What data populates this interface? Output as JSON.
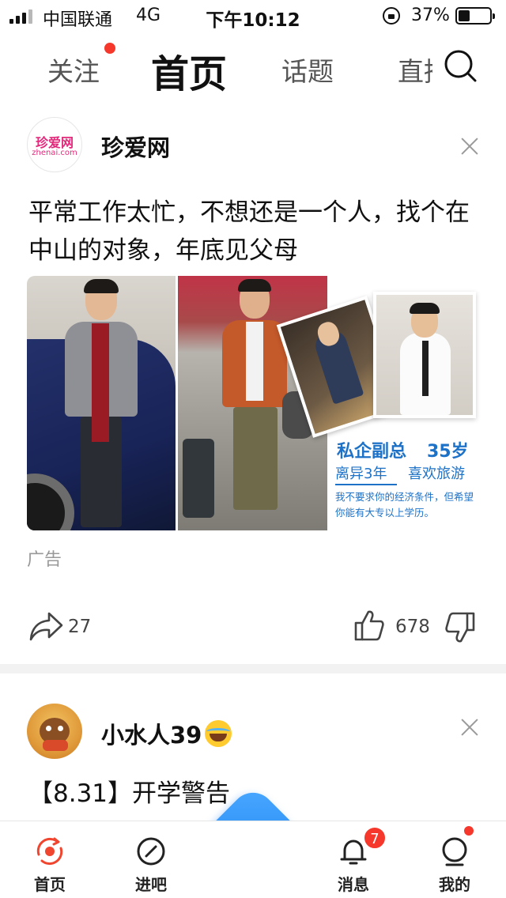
{
  "status_bar": {
    "carrier": "中国联通",
    "network": "4G",
    "time": "下午10:12",
    "battery_percent": "37%",
    "battery_level": 0.37,
    "signal_bars": 3
  },
  "top_tabs": {
    "follow": "关注",
    "home": "首页",
    "topic": "话题",
    "live": "直播"
  },
  "posts": [
    {
      "author": "珍爱网",
      "brand_logo_cn": "珍爱网",
      "brand_logo_en": "zhenai.com",
      "text": "平常工作太忙，不想还是一个人，找个在中山的对象，年底见父母",
      "ad_image": {
        "line1": "私企副总",
        "line1_age": "35岁",
        "line2": "离异3年",
        "line2_hobby": "喜欢旅游",
        "line3": "我不要求你的经济条件，但希望你能有大专以上学历。"
      },
      "ad_label": "广告",
      "share_count": "27",
      "like_count": "678"
    },
    {
      "author": "小水人39",
      "text": "【8.31】开学警告"
    }
  ],
  "bottom_nav": {
    "home": "首页",
    "jinba": "进吧",
    "messages": "消息",
    "messages_badge": "7",
    "mine": "我的"
  },
  "colors": {
    "accent_yellow": "#ffe600",
    "badge_red": "#f5382b",
    "fab_blue": "#1a7ff0",
    "ad_blue": "#1d72c8",
    "brand_pink": "#e2297a"
  }
}
